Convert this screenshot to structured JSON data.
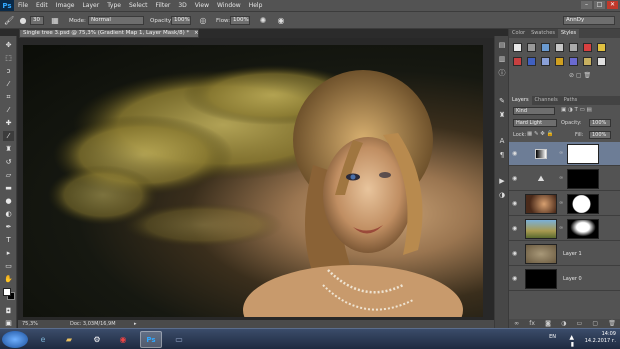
{
  "menubar": {
    "logo": "Ps",
    "items": [
      "File",
      "Edit",
      "Image",
      "Layer",
      "Type",
      "Select",
      "Filter",
      "3D",
      "View",
      "Window",
      "Help"
    ],
    "window_controls": [
      "–",
      "□",
      "✕"
    ]
  },
  "options": {
    "brush_size": "30",
    "mode_label": "Mode:",
    "mode_value": "Normal",
    "opacity_label": "Opacity:",
    "opacity_value": "100%",
    "flow_label": "Flow:",
    "flow_value": "100%",
    "workspace": "AnnDy"
  },
  "document": {
    "tab_title": "Single tree 3.psd @ 75,3% (Gradient Map 1, Layer Mask/8) *",
    "close": "×"
  },
  "status": {
    "zoom": "75,3%",
    "doc_info": "Doc: 3,03M/16,9M"
  },
  "panels": {
    "top_tabs": [
      "Color",
      "Swatches",
      "Styles"
    ],
    "top_active": "Styles",
    "layer_tabs": [
      "Layers",
      "Channels",
      "Paths"
    ],
    "layer_active": "Layers",
    "filter_kind": "Kind",
    "blend_mode": "Hard Light",
    "opacity_label": "Opacity:",
    "opacity_value": "100%",
    "lock_label": "Lock:",
    "fill_label": "Fill:",
    "fill_value": "100%",
    "layers": [
      {
        "name": "",
        "type": "gradient-map",
        "selected": true
      },
      {
        "name": "",
        "type": "levels",
        "selected": false
      },
      {
        "name": "",
        "type": "face",
        "selected": false
      },
      {
        "name": "",
        "type": "tree",
        "selected": false
      },
      {
        "name": "Layer 1",
        "type": "texture",
        "selected": false
      },
      {
        "name": "Layer 0",
        "type": "black",
        "selected": false
      }
    ]
  },
  "taskbar": {
    "lang": "EN",
    "time": "14:09",
    "date": "14.2.2017 г."
  },
  "colors": {
    "chrome": "#535353",
    "selected_layer": "#6d7d96",
    "accent": "#31a8ff"
  }
}
